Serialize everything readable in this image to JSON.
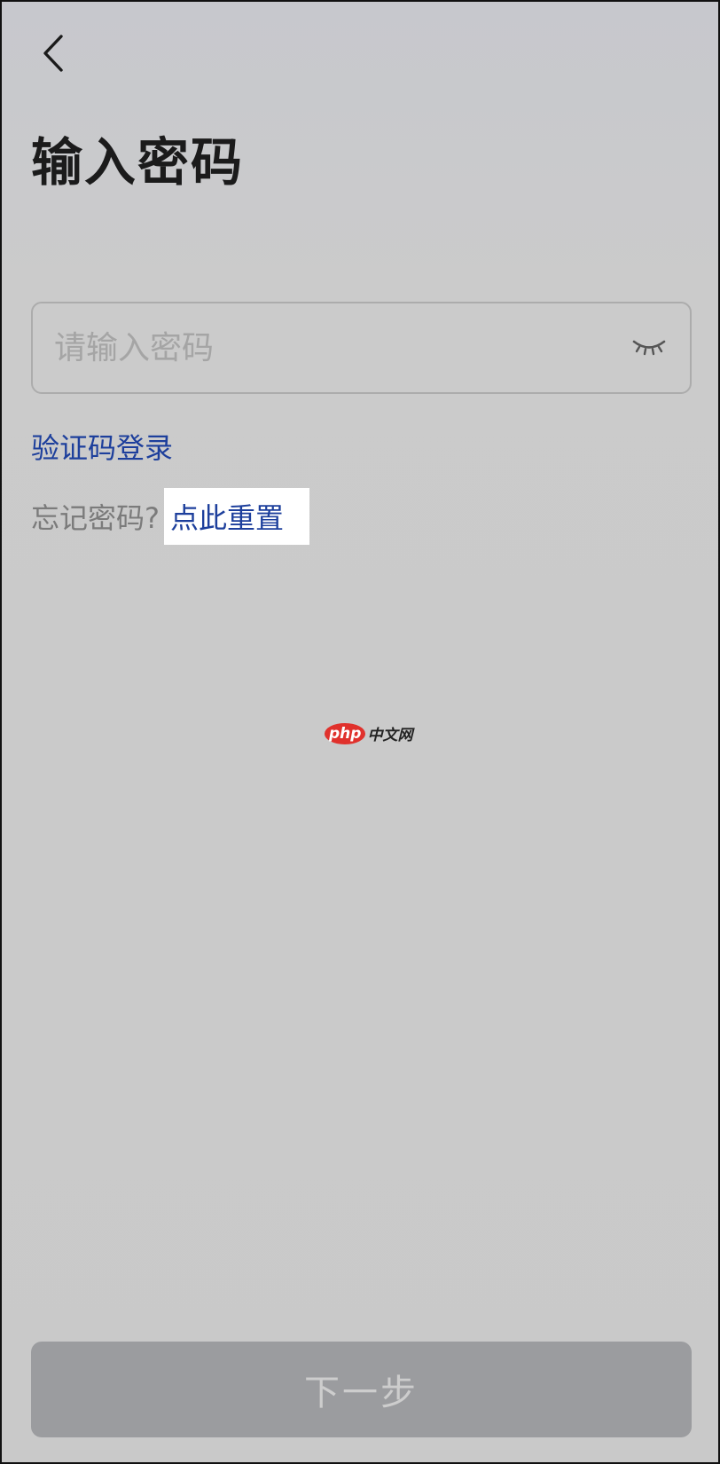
{
  "header": {
    "back_icon": "chevron-left-icon",
    "title": "输入密码"
  },
  "password": {
    "value": "",
    "placeholder": "请输入密码",
    "visibility_icon": "eye-closed-icon"
  },
  "links": {
    "sms_login": "验证码登录",
    "forgot_prompt": "忘记密码?",
    "reset": "点此重置"
  },
  "watermark": {
    "php": "php",
    "site": "中文网"
  },
  "footer": {
    "next_label": "下一步"
  },
  "colors": {
    "link": "#1d3f9c",
    "title": "#1b1b1b",
    "button_disabled_bg": "#9b9c9f",
    "button_disabled_text": "#cdcdcd",
    "watermark_brand": "#e0312c"
  }
}
